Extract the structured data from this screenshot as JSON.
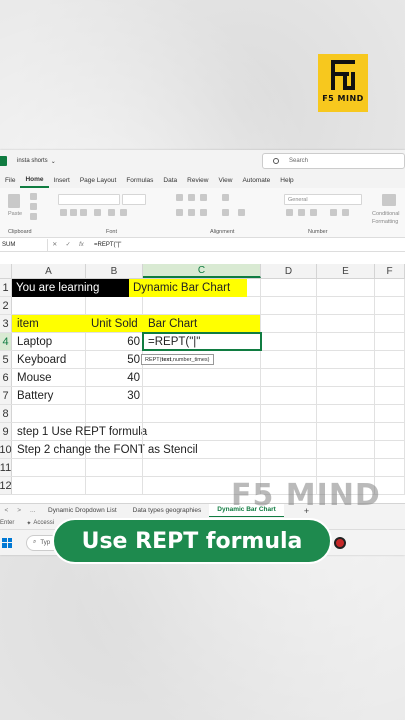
{
  "brand": {
    "logo_text": "F5 MIND",
    "watermark": "F5 MIND",
    "accent": "#f7c81e"
  },
  "window": {
    "file_name": "insta shorts",
    "search_placeholder": "Search"
  },
  "menu": [
    "File",
    "Home",
    "Insert",
    "Page Layout",
    "Formulas",
    "Data",
    "Review",
    "View",
    "Automate",
    "Help"
  ],
  "ribbon": {
    "paste": "Paste",
    "clipboard": "Clipboard",
    "font": "Font",
    "alignment": "Alignment",
    "number": "Number",
    "number_format": "General",
    "conditional": "Conditional Formatting"
  },
  "formula_bar": {
    "name_box": "SUM",
    "fx": "fx",
    "formula": "=REPT(\"|\""
  },
  "columns": [
    "A",
    "B",
    "C",
    "D",
    "E",
    "F"
  ],
  "rows": {
    "r1": {
      "num": "1",
      "a": "You are learning",
      "c": "Dynamic Bar Chart"
    },
    "r2": {
      "num": "2"
    },
    "r3": {
      "num": "3",
      "a": "item",
      "b": "Unit Sold",
      "c": "Bar Chart"
    },
    "r4": {
      "num": "4",
      "a": "Laptop",
      "b": "60",
      "c": "=REPT(\"|\""
    },
    "r5": {
      "num": "5",
      "a": "Keyboard",
      "b": "50"
    },
    "r6": {
      "num": "6",
      "a": "Mouse",
      "b": "40"
    },
    "r7": {
      "num": "7",
      "a": "Battery",
      "b": "30"
    },
    "r8": {
      "num": "8"
    },
    "r9": {
      "num": "9",
      "a": "step 1 Use REPT formula"
    },
    "r10": {
      "num": "10",
      "a": "Step 2 change the FONT as Stencil"
    },
    "r11": {
      "num": "11"
    },
    "r12": {
      "num": "12"
    }
  },
  "tooltip": {
    "func": "REPT(",
    "arg1": "text",
    "sep": ", ",
    "arg2": "number_times",
    "close": ")"
  },
  "sheet_tabs": [
    "Dynamic Dropdown List",
    "Data types geographies",
    "Dynamic Bar Chart"
  ],
  "sheet_nav": {
    "prev": "<",
    "next": ">",
    "more": "...",
    "add": "+"
  },
  "status": {
    "mode": "Enter",
    "accessibility": "Accessi"
  },
  "taskbar": {
    "search": "Typ"
  },
  "banner": {
    "text": "Use REPT formula"
  }
}
